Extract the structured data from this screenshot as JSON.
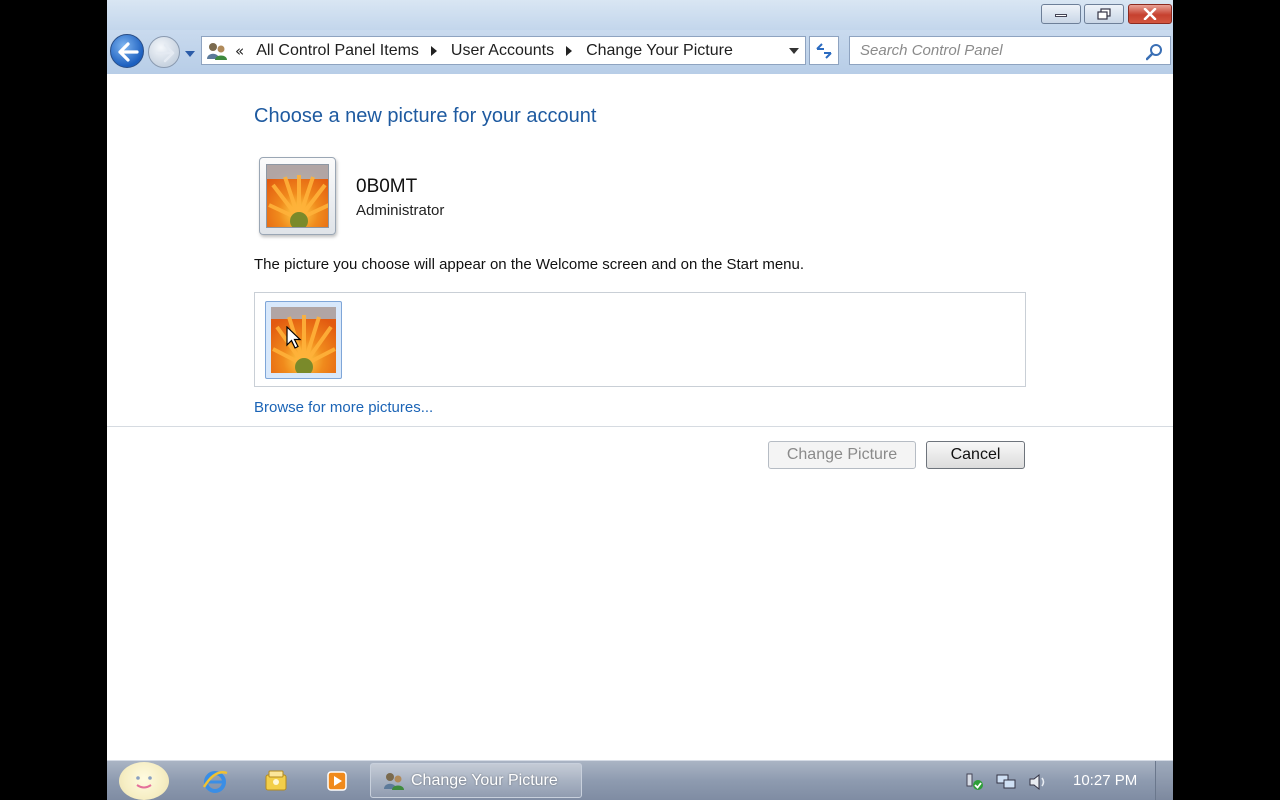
{
  "window": {
    "title_buttons": {
      "minimize_icon": "minimize-icon",
      "maximize_icon": "restore-icon",
      "close_icon": "close-icon"
    }
  },
  "navbar": {
    "back_icon": "back-arrow-icon",
    "forward_icon": "forward-arrow-icon",
    "chevron": "«",
    "breadcrumbs": [
      "All Control Panel Items",
      "User Accounts",
      "Change Your Picture"
    ],
    "search_placeholder": "Search Control Panel"
  },
  "main": {
    "title": "Choose a new picture for your account",
    "account": {
      "name": "0B0MT",
      "role": "Administrator"
    },
    "description": "The picture you choose will appear on the Welcome screen and on the Start menu.",
    "browse_link": "Browse for more pictures...",
    "buttons": {
      "change_picture": "Change Picture",
      "cancel": "Cancel"
    }
  },
  "taskbar": {
    "active_task": "Change Your Picture",
    "clock": "10:27 PM",
    "pinned": [
      "internet-explorer-icon",
      "windows-explorer-icon",
      "media-player-icon"
    ],
    "tray": [
      "action-center-icon",
      "network-icon",
      "volume-icon"
    ]
  },
  "colors": {
    "accent_title": "#1e5aa0",
    "link": "#1b64b6",
    "taskbar": "#8e9bb0"
  }
}
